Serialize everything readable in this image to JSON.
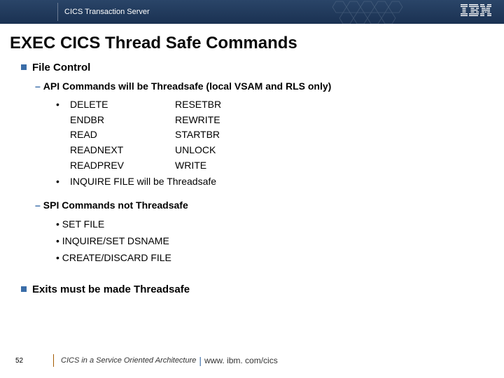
{
  "header": {
    "product": "CICS Transaction Server",
    "brand": "IBM"
  },
  "title": "EXEC CICS Thread Safe Commands",
  "section1": {
    "heading": "File Control",
    "api_line": "API Commands will be Threadsafe (local VSAM and RLS only)",
    "commands_col1": [
      "DELETE",
      "ENDBR",
      "READ",
      "READNEXT",
      "READPREV"
    ],
    "commands_col2": [
      "RESETBR",
      "REWRITE",
      "STARTBR",
      "UNLOCK",
      "WRITE"
    ],
    "inquire_line": "INQUIRE FILE will be Threadsafe",
    "spi_line_prefix": "SPI Commands ",
    "spi_line_bold": "not",
    "spi_line_suffix": " Threadsafe",
    "spi_items": [
      "SET FILE",
      "INQUIRE/SET DSNAME",
      "CREATE/DISCARD FILE"
    ]
  },
  "section2": {
    "heading": "Exits must be made Threadsafe"
  },
  "footer": {
    "page": "52",
    "deck_title": "CICS in a Service Oriented Architecture",
    "url": "www. ibm. com/cics"
  }
}
